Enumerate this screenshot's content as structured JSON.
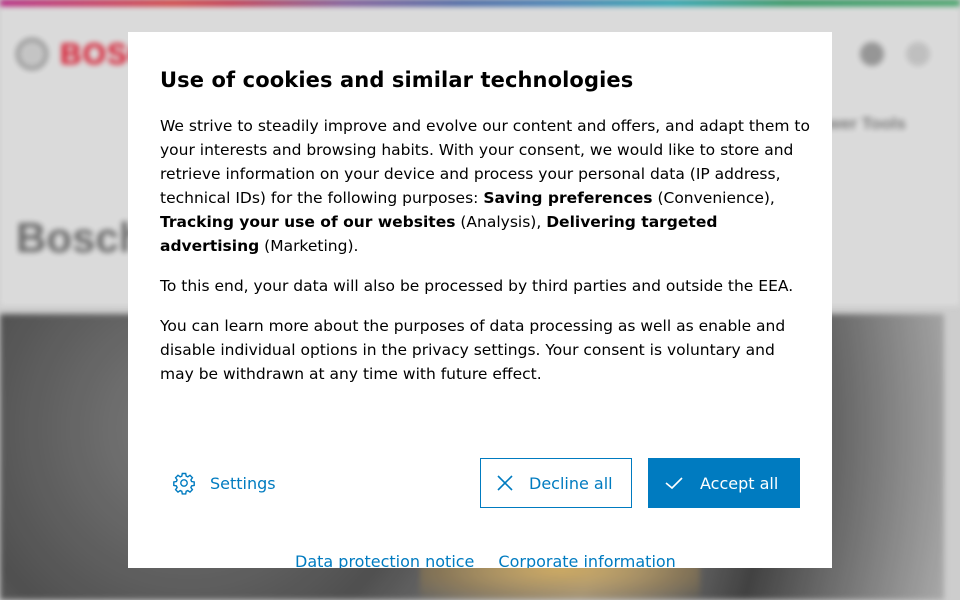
{
  "background": {
    "logo_text": "BOSCH",
    "nav_text": "Power Tools",
    "page_title": "Bosch",
    "icons": [
      "bosch-logo-icon",
      "search-icon",
      "user-icon"
    ]
  },
  "dialog": {
    "title": "Use of cookies and similar technologies",
    "para1": {
      "intro": "We strive to steadily improve and evolve our content and offers, and adapt them to your interests and browsing habits. With your consent, we would like to store and retrieve information on your device and process your personal data (IP ad­dress, technical IDs) for the following purposes: ",
      "purpose1": "Saving preferences",
      "purpose1_cat": " (Convenience), ",
      "purpose2": "Tracking your use of our websites",
      "purpose2_cat": " (Analysis), ",
      "purpose3": "Delivering targeted advertising",
      "purpose3_cat": " (Marketing)."
    },
    "para2": "To this end, your data will also be processed by third parties and outside the EEA.",
    "para3": "You can learn more about the purposes of data processing as well as enable and disable individual options in the privacy settings. Your consent is voluntary and may be withdrawn at any time with future effect.",
    "settings_label": "Settings",
    "decline_label": "Decline all",
    "accept_label": "Accept all",
    "links": [
      "Data protection notice",
      "Corporate information"
    ]
  },
  "colors": {
    "accent": "#007bc0",
    "brand_red": "#e2001a"
  }
}
